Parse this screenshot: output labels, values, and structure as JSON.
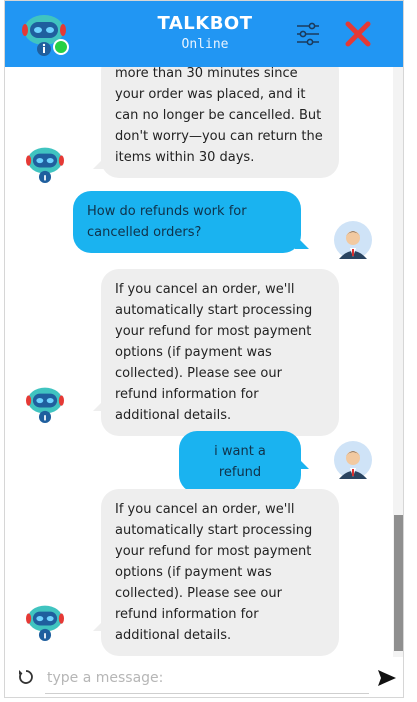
{
  "header": {
    "title": "TALKBOT",
    "status": "Online"
  },
  "messages": [
    {
      "sender": "bot",
      "text": "more than 30 minutes since your order was placed, and it can no longer be cancelled. But don't worry—you can return the items within 30 days."
    },
    {
      "sender": "user",
      "text": "How do refunds work for cancelled orders?"
    },
    {
      "sender": "bot",
      "text": "If you cancel an order, we'll automatically start processing your refund for most payment options (if payment was collected). Please see our refund information for additional details."
    },
    {
      "sender": "user",
      "text": "i want a refund"
    },
    {
      "sender": "bot",
      "text": "If you cancel an order, we'll automatically start processing your refund for most payment options (if payment was collected). Please see our refund information for additional details."
    }
  ],
  "composer": {
    "placeholder": "type a message:"
  },
  "colors": {
    "header": "#2196f3",
    "user_bubble": "#1ab3f0",
    "bot_bubble": "#eeeeee",
    "online": "#27d045",
    "close": "#e53935"
  },
  "icons": {
    "settings": "sliders-icon",
    "close": "close-icon",
    "refresh": "refresh-icon",
    "send": "send-icon"
  }
}
